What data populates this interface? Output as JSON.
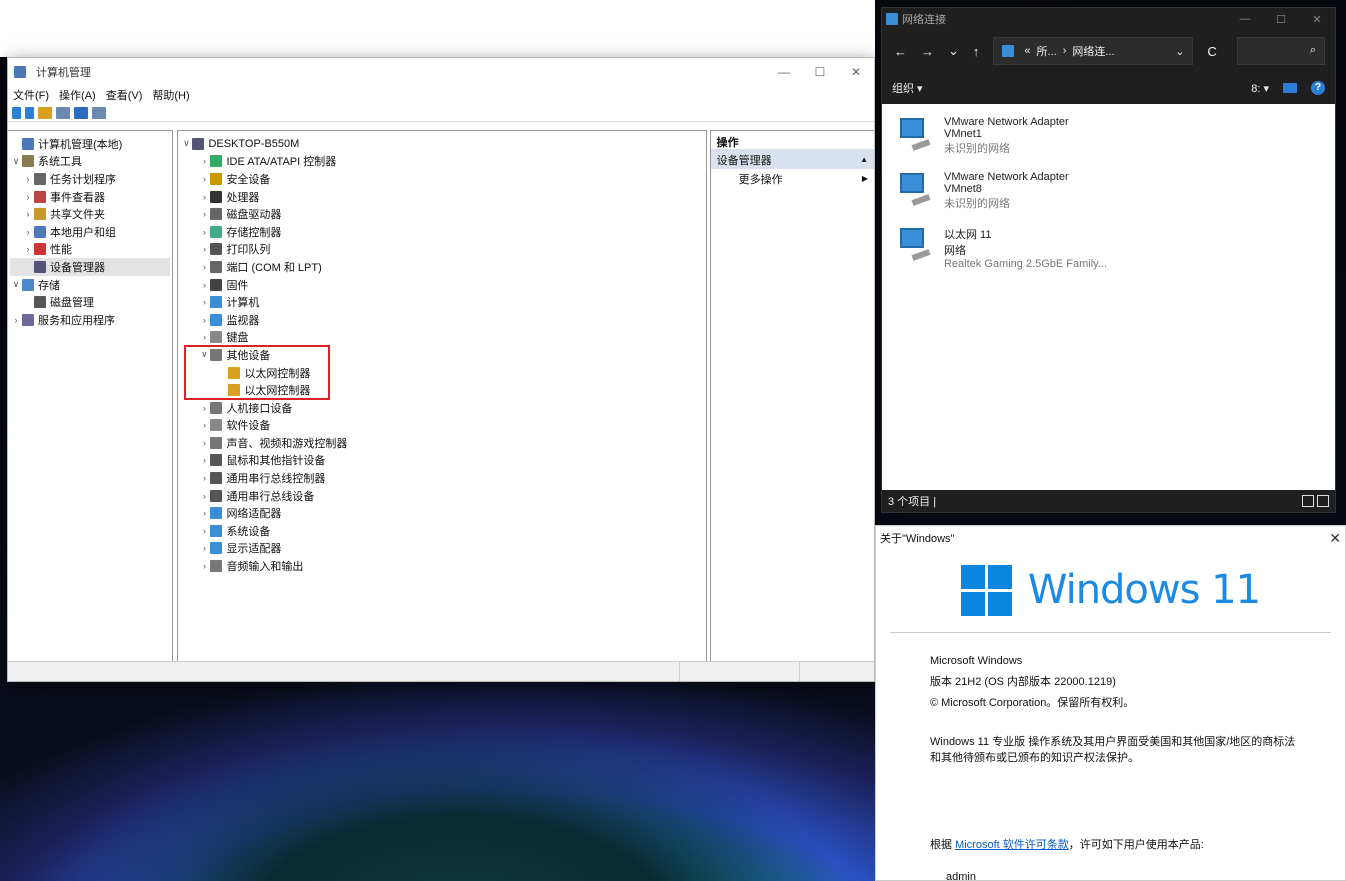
{
  "cm": {
    "title": "计算机管理",
    "controls": {
      "min": "—",
      "max": "☐",
      "close": "✕"
    },
    "menu": [
      "文件(F)",
      "操作(A)",
      "查看(V)",
      "帮助(H)"
    ],
    "left_tree": [
      {
        "label": "计算机管理(本地)",
        "depth": 0,
        "arrow": "",
        "icon": "computer-management-icon",
        "color": "#4a78b8"
      },
      {
        "label": "系统工具",
        "depth": 0,
        "arrow": "∨",
        "icon": "tools-icon",
        "color": "#8a7a50"
      },
      {
        "label": "任务计划程序",
        "depth": 1,
        "arrow": "›",
        "icon": "clock-icon",
        "color": "#666"
      },
      {
        "label": "事件查看器",
        "depth": 1,
        "arrow": "›",
        "icon": "event-viewer-icon",
        "color": "#b44"
      },
      {
        "label": "共享文件夹",
        "depth": 1,
        "arrow": "›",
        "icon": "shared-folder-icon",
        "color": "#c99a2c"
      },
      {
        "label": "本地用户和组",
        "depth": 1,
        "arrow": "›",
        "icon": "users-icon",
        "color": "#4a78b8"
      },
      {
        "label": "性能",
        "depth": 1,
        "arrow": "›",
        "icon": "performance-icon",
        "color": "#c33"
      },
      {
        "label": "设备管理器",
        "depth": 1,
        "arrow": "",
        "icon": "device-manager-icon",
        "color": "#557",
        "selected": true
      },
      {
        "label": "存储",
        "depth": 0,
        "arrow": "∨",
        "icon": "storage-icon",
        "color": "#4a88c8"
      },
      {
        "label": "磁盘管理",
        "depth": 1,
        "arrow": "",
        "icon": "disk-icon",
        "color": "#555"
      },
      {
        "label": "服务和应用程序",
        "depth": 0,
        "arrow": "›",
        "icon": "services-icon",
        "color": "#6a6a9a"
      }
    ],
    "device_tree": [
      {
        "label": "DESKTOP-B550M",
        "depth": 0,
        "arrow": "∨",
        "icon": "computer-icon",
        "color": "#557"
      },
      {
        "label": "IDE ATA/ATAPI 控制器",
        "depth": 1,
        "arrow": "›",
        "icon": "ide-controller-icon",
        "color": "#3a6"
      },
      {
        "label": "安全设备",
        "depth": 1,
        "arrow": "›",
        "icon": "security-device-icon",
        "color": "#c90"
      },
      {
        "label": "处理器",
        "depth": 1,
        "arrow": "›",
        "icon": "processor-icon",
        "color": "#333"
      },
      {
        "label": "磁盘驱动器",
        "depth": 1,
        "arrow": "›",
        "icon": "disk-drive-icon",
        "color": "#666"
      },
      {
        "label": "存储控制器",
        "depth": 1,
        "arrow": "›",
        "icon": "storage-controller-icon",
        "color": "#4a8"
      },
      {
        "label": "打印队列",
        "depth": 1,
        "arrow": "›",
        "icon": "printer-icon",
        "color": "#555"
      },
      {
        "label": "端口 (COM 和 LPT)",
        "depth": 1,
        "arrow": "›",
        "icon": "port-icon",
        "color": "#666"
      },
      {
        "label": "固件",
        "depth": 1,
        "arrow": "›",
        "icon": "firmware-icon",
        "color": "#444"
      },
      {
        "label": "计算机",
        "depth": 1,
        "arrow": "›",
        "icon": "computer-icon",
        "color": "#3a8ed8"
      },
      {
        "label": "监视器",
        "depth": 1,
        "arrow": "›",
        "icon": "monitor-icon",
        "color": "#3a8ed8"
      },
      {
        "label": "键盘",
        "depth": 1,
        "arrow": "›",
        "icon": "keyboard-icon",
        "color": "#888"
      },
      {
        "label": "其他设备",
        "depth": 1,
        "arrow": "∨",
        "icon": "unknown-device-icon",
        "color": "#777"
      },
      {
        "label": "以太网控制器",
        "depth": 2,
        "arrow": "",
        "icon": "warning-device-icon",
        "color": "#d9a020"
      },
      {
        "label": "以太网控制器",
        "depth": 2,
        "arrow": "",
        "icon": "warning-device-icon",
        "color": "#d9a020"
      },
      {
        "label": "人机接口设备",
        "depth": 1,
        "arrow": "›",
        "icon": "hid-icon",
        "color": "#777"
      },
      {
        "label": "软件设备",
        "depth": 1,
        "arrow": "›",
        "icon": "software-device-icon",
        "color": "#888"
      },
      {
        "label": "声音、视频和游戏控制器",
        "depth": 1,
        "arrow": "›",
        "icon": "speaker-icon",
        "color": "#777"
      },
      {
        "label": "鼠标和其他指针设备",
        "depth": 1,
        "arrow": "›",
        "icon": "mouse-icon",
        "color": "#555"
      },
      {
        "label": "通用串行总线控制器",
        "depth": 1,
        "arrow": "›",
        "icon": "usb-icon",
        "color": "#555"
      },
      {
        "label": "通用串行总线设备",
        "depth": 1,
        "arrow": "›",
        "icon": "usb-icon",
        "color": "#555"
      },
      {
        "label": "网络适配器",
        "depth": 1,
        "arrow": "›",
        "icon": "network-adapter-icon",
        "color": "#3a8ed8"
      },
      {
        "label": "系统设备",
        "depth": 1,
        "arrow": "›",
        "icon": "system-device-icon",
        "color": "#3a8ed8"
      },
      {
        "label": "显示适配器",
        "depth": 1,
        "arrow": "›",
        "icon": "display-adapter-icon",
        "color": "#3a8ed8"
      },
      {
        "label": "音频输入和输出",
        "depth": 1,
        "arrow": "›",
        "icon": "audio-icon",
        "color": "#777"
      }
    ],
    "actions": {
      "header": "操作",
      "section": "设备管理器",
      "section_arrow": "▲",
      "item": "更多操作",
      "item_arrow": "▶"
    }
  },
  "nc": {
    "title": "网络连接",
    "controls": {
      "min": "—",
      "max": "☐",
      "close": "✕"
    },
    "nav": {
      "back": "←",
      "forward": "→",
      "recent": "⌄",
      "up": "↑",
      "refresh": "C",
      "search": "⌕"
    },
    "path": {
      "sep1": "«",
      "part1": "所...",
      "sep2": "›",
      "part2": "网络连...",
      "dropdown": "⌄"
    },
    "organize": "组织 ▾",
    "view_btn": "8: ▾",
    "help": "?",
    "adapters": [
      {
        "name": "VMware Network Adapter",
        "sub": "VMnet1",
        "status": "未识别的网络"
      },
      {
        "name": "VMware Network Adapter",
        "sub": "VMnet8",
        "status": "未识别的网络"
      },
      {
        "name": "以太网 11",
        "sub": "网络",
        "status": "Realtek Gaming 2.5GbE Family..."
      }
    ],
    "status_text": "3 个项目  |"
  },
  "about": {
    "title": "关于\"Windows\"",
    "close": "✕",
    "logo_text": "Windows 11",
    "line1": "Microsoft Windows",
    "line2": "版本 21H2 (OS 内部版本 22000.1219)",
    "line3": "© Microsoft Corporation。保留所有权利。",
    "legal": "Windows 11 专业版 操作系统及其用户界面受美国和其他国家/地区的商标法和其他待颁布或已颁布的知识产权法保护。",
    "license_prefix": "根据",
    "license_link": "Microsoft 软件许可条款",
    "license_suffix": "，许可如下用户使用本产品:",
    "user": "admin"
  }
}
